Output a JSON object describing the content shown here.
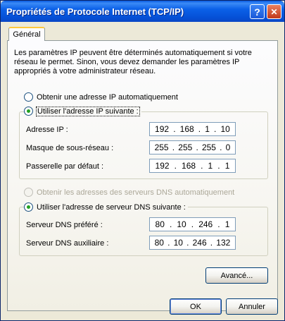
{
  "window": {
    "title": "Propriétés de Protocole Internet (TCP/IP)",
    "help_glyph": "?",
    "close_glyph": "✕"
  },
  "tabs": [
    {
      "label": "Général"
    }
  ],
  "description": "Les paramètres IP peuvent être déterminés automatiquement si votre réseau le permet. Sinon, vous devez demander les paramètres IP appropriés à votre administrateur réseau.",
  "ip_mode": {
    "auto": {
      "label": "Obtenir une adresse IP automatiquement",
      "checked": false
    },
    "manual": {
      "label": "Utiliser l'adresse IP suivante :",
      "checked": true
    }
  },
  "ip_fields": {
    "address": {
      "label": "Adresse IP :",
      "octets": [
        "192",
        "168",
        "1",
        "10"
      ]
    },
    "subnet": {
      "label": "Masque de sous-réseau :",
      "octets": [
        "255",
        "255",
        "255",
        "0"
      ]
    },
    "gateway": {
      "label": "Passerelle par défaut :",
      "octets": [
        "192",
        "168",
        "1",
        "1"
      ]
    }
  },
  "dns_mode": {
    "auto": {
      "label": "Obtenir les adresses des serveurs DNS automatiquement",
      "checked": false,
      "enabled": false
    },
    "manual": {
      "label": "Utiliser l'adresse de serveur DNS suivante :",
      "checked": true
    }
  },
  "dns_fields": {
    "preferred": {
      "label": "Serveur DNS préféré :",
      "octets": [
        "80",
        "10",
        "246",
        "1"
      ]
    },
    "alternate": {
      "label": "Serveur DNS auxiliaire :",
      "octets": [
        "80",
        "10",
        "246",
        "132"
      ]
    }
  },
  "buttons": {
    "advanced": "Avancé...",
    "ok": "OK",
    "cancel": "Annuler"
  },
  "colors": {
    "titlebar": "#0b61e8",
    "radio_dot": "#21a121",
    "face": "#ece9d8"
  }
}
